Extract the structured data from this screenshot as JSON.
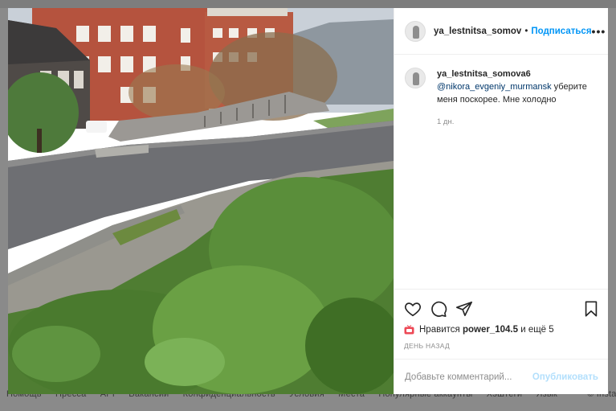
{
  "backdrop": {
    "footer_links": [
      "Помощь",
      "Пресса",
      "API",
      "Вакансии",
      "Конфиденциальность",
      "Условия",
      "Места",
      "Популярные аккаунты",
      "Хэштеги",
      "Язык"
    ],
    "footer_right": "© Instagram от Facebook"
  },
  "post": {
    "author": "ya_lestnitsa_somov",
    "separator": "•",
    "follow_label": "Подписаться",
    "more_icon": "more-horizontal-icon"
  },
  "caption": {
    "author": "ya_lestnitsa_somova6",
    "mention": "@nikora_evgeniy_murmansk",
    "text": " уберите меня поскорее. Мне холодно",
    "time": "1 дн."
  },
  "actions": {
    "icons": [
      "heart-icon",
      "comment-icon",
      "share-icon",
      "bookmark-icon"
    ]
  },
  "likes": {
    "prefix": "Нравится",
    "user": "power_104.5",
    "suffix": "и ещё 5"
  },
  "date_label": "ДЕНЬ НАЗАД",
  "add_comment": {
    "placeholder": "Добавьте комментарий...",
    "publish_label": "Опубликовать"
  },
  "colors": {
    "accent": "#0095f6",
    "publish_disabled": "#b2dffc",
    "mention": "#00376b"
  }
}
